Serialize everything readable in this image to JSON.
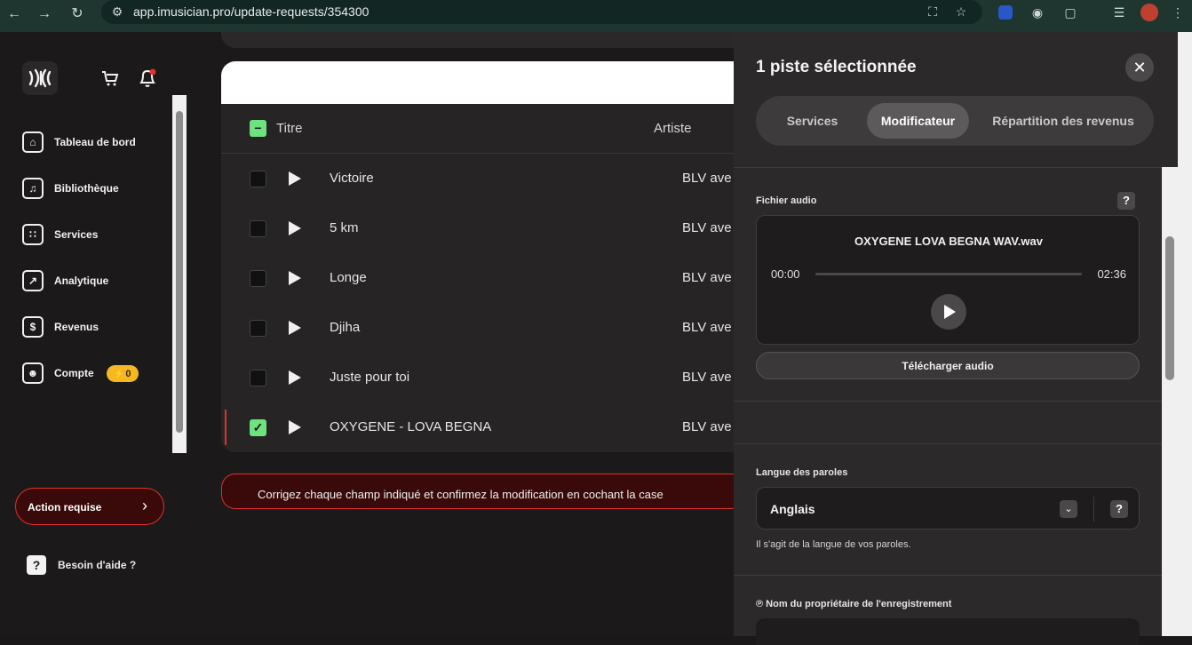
{
  "browser": {
    "url": "app.imusician.pro/update-requests/354300"
  },
  "sidebar": {
    "items": [
      {
        "label": "Tableau de bord",
        "icon": "home-icon"
      },
      {
        "label": "Bibliothèque",
        "icon": "library-icon"
      },
      {
        "label": "Services",
        "icon": "grid-icon"
      },
      {
        "label": "Analytique",
        "icon": "chart-icon"
      },
      {
        "label": "Revenus",
        "icon": "dollar-icon"
      },
      {
        "label": "Compte",
        "icon": "user-icon"
      }
    ],
    "account_badge": "⚡0",
    "action_label": "Action requise",
    "help_label": "Besoin d'aide ?"
  },
  "table": {
    "col_title": "Titre",
    "col_artist": "Artiste",
    "rows": [
      {
        "title": "Victoire",
        "artist": "BLV ave",
        "selected": false
      },
      {
        "title": "5 km",
        "artist": "BLV ave",
        "selected": false
      },
      {
        "title": "Longe",
        "artist": "BLV ave",
        "selected": false
      },
      {
        "title": "Djiha",
        "artist": "BLV ave",
        "selected": false
      },
      {
        "title": "Juste pour toi",
        "artist": "BLV ave",
        "selected": false
      },
      {
        "title": "OXYGENE - LOVA BEGNA",
        "artist": "BLV ave",
        "selected": true
      }
    ],
    "info": "Corrigez chaque champ indiqué et confirmez la modification en cochant la case"
  },
  "panel": {
    "title": "1 piste sélectionnée",
    "tabs": [
      {
        "label": "Services",
        "active": false
      },
      {
        "label": "Modificateur",
        "active": true
      },
      {
        "label": "Répartition des revenus",
        "active": false
      }
    ],
    "audio_label": "Fichier audio",
    "audio_file": "OXYGENE LOVA BEGNA WAV.wav",
    "time_start": "00:00",
    "time_end": "02:36",
    "download_label": "Télécharger audio",
    "lang_label": "Langue des paroles",
    "lang_value": "Anglais",
    "lang_hint": "Il s'agit de la langue de vos paroles.",
    "owner_label": "℗ Nom du propriétaire de l'enregistrement"
  },
  "colors": {
    "accent_green": "#6ee27f",
    "alert_red": "#e03030",
    "badge_yellow": "#f5b820"
  }
}
